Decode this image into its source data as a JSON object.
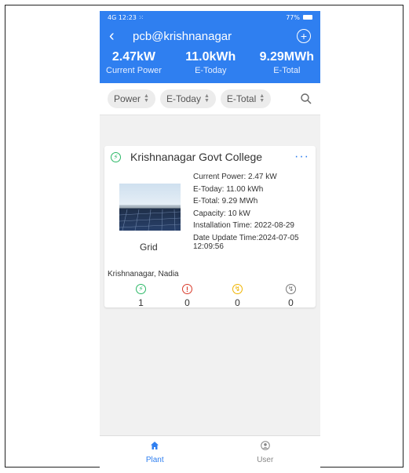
{
  "status_bar": {
    "left": "4G 12:23 ⁙",
    "right": "77%"
  },
  "header": {
    "back_icon": "chevron-left-icon",
    "title": "pcb@krishnanagar",
    "add_icon": "plus-circle-icon"
  },
  "summary": [
    {
      "value": "2.47kW",
      "label": "Current Power"
    },
    {
      "value": "11.0kWh",
      "label": "E-Today"
    },
    {
      "value": "9.29MWh",
      "label": "E-Total"
    }
  ],
  "sort": {
    "power": "Power",
    "etoday": "E-Today",
    "etotal": "E-Total",
    "search_icon": "search-icon"
  },
  "plant": {
    "name": "Krishnanagar Govt College",
    "status_icon": "bolt-circle-icon",
    "details": {
      "current_power": "Current Power: 2.47 kW",
      "e_today": "E-Today: 11.00 kWh",
      "e_total": "E-Total: 9.29 MWh",
      "capacity": "Capacity: 10 kW",
      "installation": "Installation Time: 2022-08-29",
      "update_line1": "Date Update Time:2024-07-05",
      "update_line2": "12:09:56"
    },
    "grid_label": "Grid",
    "location": "Krishnanagar, Nadia"
  },
  "status_counts": {
    "normal": "1",
    "fault": "0",
    "offline": "0",
    "other": "0"
  },
  "colors": {
    "primary": "#2f7ff0",
    "normal": "#2bb866",
    "fault": "#d93a2a",
    "warning": "#f0b400"
  },
  "nav": {
    "plant": "Plant",
    "user": "User"
  }
}
